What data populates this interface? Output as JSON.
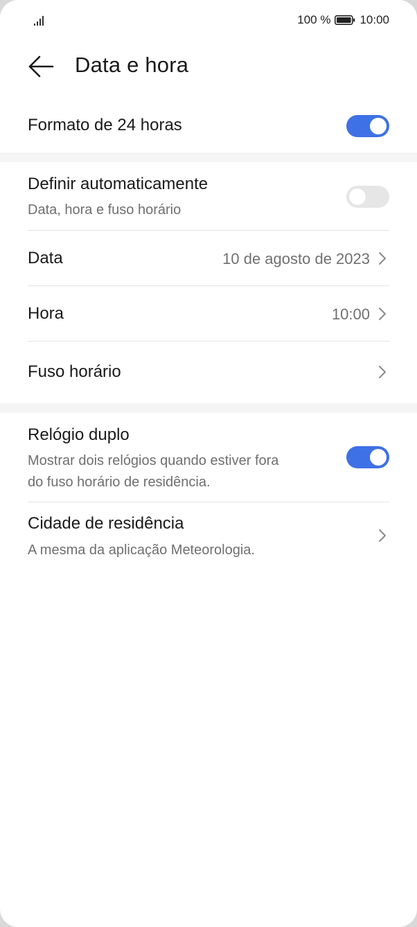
{
  "status_bar": {
    "battery_percent": "100 %",
    "time": "10:00",
    "signal_icon": "signal-icon",
    "battery_icon": "battery-icon"
  },
  "header": {
    "title": "Data e hora",
    "back_icon": "arrow-left-icon"
  },
  "settings": {
    "format24": {
      "label": "Formato de 24 horas",
      "enabled": true
    },
    "auto": {
      "label": "Definir automaticamente",
      "sublabel": "Data, hora e fuso horário",
      "enabled": false
    },
    "date": {
      "label": "Data",
      "value": "10 de agosto de 2023"
    },
    "time": {
      "label": "Hora",
      "value": "10:00"
    },
    "timezone": {
      "label": "Fuso horário"
    },
    "dual_clock": {
      "label": "Relógio duplo",
      "sublabel_line1": "Mostrar dois relógios quando estiver fora",
      "sublabel_line2": "do fuso horário de residência.",
      "enabled": true
    },
    "home_city": {
      "label": "Cidade de residência",
      "sublabel": "A mesma da aplicação Meteorologia."
    }
  },
  "colors": {
    "accent": "#3f71e6",
    "toggle_off": "#e6e6e6",
    "text_primary": "#1a1a1a",
    "text_secondary": "#6f6f6f"
  }
}
